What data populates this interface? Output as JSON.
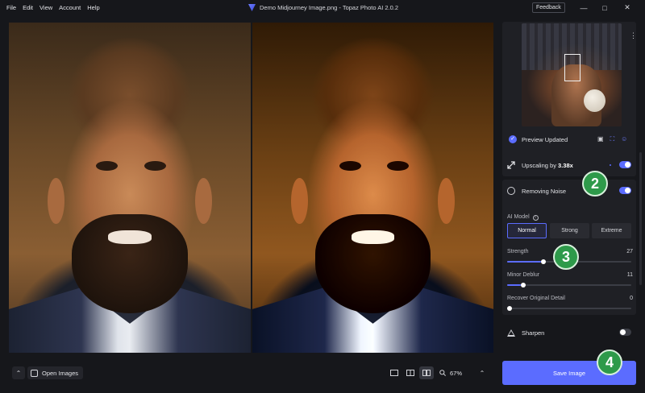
{
  "menu": [
    "File",
    "Edit",
    "View",
    "Account",
    "Help"
  ],
  "window": {
    "title": "Demo Midjourney Image.png - Topaz Photo AI 2.0.2",
    "feedback_label": "Feedback"
  },
  "bottom_toolbar": {
    "open_images_label": "Open Images",
    "zoom_level": "67%"
  },
  "preview": {
    "status": "Preview Updated"
  },
  "upscaling": {
    "prefix": "Upscaling by ",
    "factor": "3.38x",
    "enabled": true
  },
  "noise": {
    "title": "Removing Noise",
    "enabled": true,
    "ai_model_label": "AI Model",
    "models": [
      "Normal",
      "Strong",
      "Extreme"
    ],
    "selected_model": "Normal",
    "sliders": [
      {
        "label": "Strength",
        "value": "27",
        "fraction": 0.27
      },
      {
        "label": "Minor Deblur",
        "value": "11",
        "fraction": 0.11
      },
      {
        "label": "Recover Original Detail",
        "value": "0",
        "fraction": 0.0
      }
    ]
  },
  "sharpen": {
    "title": "Sharpen",
    "enabled": false
  },
  "save_button_label": "Save Image",
  "badges": [
    "2",
    "3",
    "4"
  ],
  "colors": {
    "accent": "#5b6cff",
    "badge": "#2e9a4a",
    "background": "#16171b",
    "panel": "#1f2025"
  },
  "icons": [
    "chevron-up-icon",
    "open-images-icon",
    "single-view-icon",
    "split-view-icon",
    "side-by-side-icon",
    "zoom-icon",
    "check-circle-icon",
    "crop-icon",
    "fullscreen-icon",
    "face-icon",
    "upscale-arrow-icon",
    "noise-icon",
    "info-icon",
    "sharpen-icon",
    "kebab-menu-icon"
  ]
}
